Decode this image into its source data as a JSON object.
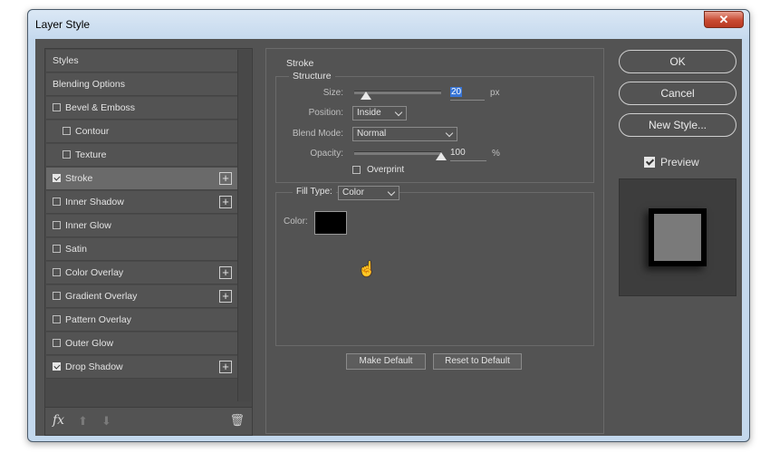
{
  "window": {
    "title": "Layer Style",
    "close_label": "✕"
  },
  "sidebar": {
    "items": [
      {
        "label": "Styles",
        "checkbox": null,
        "indent": false,
        "plus": false,
        "selected": false
      },
      {
        "label": "Blending Options",
        "checkbox": null,
        "indent": false,
        "plus": false,
        "selected": false
      },
      {
        "label": "Bevel & Emboss",
        "checkbox": false,
        "indent": false,
        "plus": false,
        "selected": false
      },
      {
        "label": "Contour",
        "checkbox": false,
        "indent": true,
        "plus": false,
        "selected": false
      },
      {
        "label": "Texture",
        "checkbox": false,
        "indent": true,
        "plus": false,
        "selected": false
      },
      {
        "label": "Stroke",
        "checkbox": true,
        "indent": false,
        "plus": true,
        "selected": true
      },
      {
        "label": "Inner Shadow",
        "checkbox": false,
        "indent": false,
        "plus": true,
        "selected": false
      },
      {
        "label": "Inner Glow",
        "checkbox": false,
        "indent": false,
        "plus": false,
        "selected": false
      },
      {
        "label": "Satin",
        "checkbox": false,
        "indent": false,
        "plus": false,
        "selected": false
      },
      {
        "label": "Color Overlay",
        "checkbox": false,
        "indent": false,
        "plus": true,
        "selected": false
      },
      {
        "label": "Gradient Overlay",
        "checkbox": false,
        "indent": false,
        "plus": true,
        "selected": false
      },
      {
        "label": "Pattern Overlay",
        "checkbox": false,
        "indent": false,
        "plus": false,
        "selected": false
      },
      {
        "label": "Outer Glow",
        "checkbox": false,
        "indent": false,
        "plus": false,
        "selected": false
      },
      {
        "label": "Drop Shadow",
        "checkbox": true,
        "indent": false,
        "plus": true,
        "selected": false
      }
    ],
    "footer": {
      "fx_label": "fx",
      "up_icon": "arrow-up-icon",
      "down_icon": "arrow-down-icon",
      "trash_icon": "trash-icon"
    }
  },
  "stroke": {
    "section_title": "Stroke",
    "structure_title": "Structure",
    "size_label": "Size:",
    "size_value": "20",
    "size_unit": "px",
    "size_slider_fraction": 0.14,
    "position_label": "Position:",
    "position_value": "Inside",
    "blend_mode_label": "Blend Mode:",
    "blend_mode_value": "Normal",
    "opacity_label": "Opacity:",
    "opacity_value": "100",
    "opacity_unit": "%",
    "opacity_slider_fraction": 1.0,
    "overprint_label": "Overprint",
    "overprint_checked": false,
    "fill_type_label": "Fill Type:",
    "fill_type_value": "Color",
    "color_label": "Color:",
    "color_value": "#000000",
    "make_default_label": "Make Default",
    "reset_default_label": "Reset to Default"
  },
  "actions": {
    "ok_label": "OK",
    "cancel_label": "Cancel",
    "new_style_label": "New Style...",
    "preview_label": "Preview",
    "preview_checked": true
  },
  "colors": {
    "panel_bg": "#535353",
    "selected_row": "#6a6a6a",
    "text": "#e4e4e4",
    "highlight": "#3875d7"
  }
}
